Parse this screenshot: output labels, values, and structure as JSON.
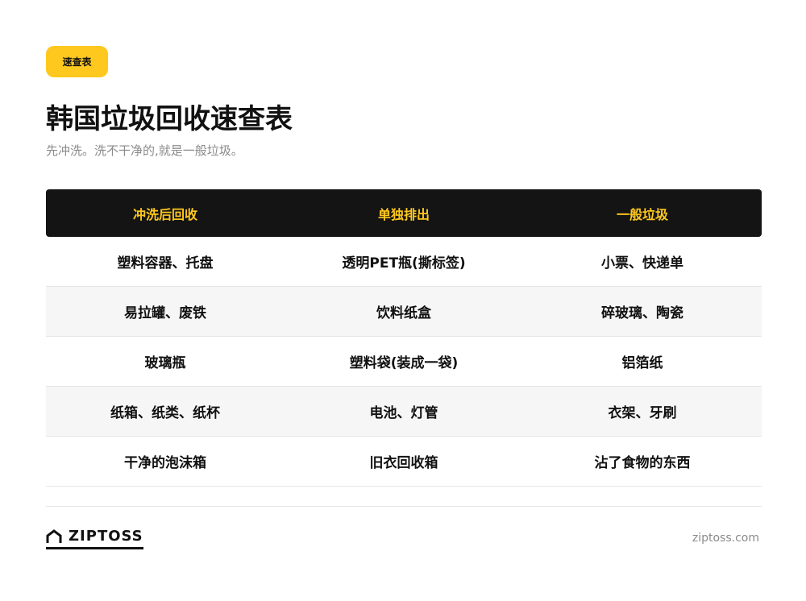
{
  "badge": "速查表",
  "title": "韩国垃圾回收速查表",
  "subtitle": "先冲洗。洗不干净的,就是一般垃圾。",
  "table": {
    "headers": [
      "冲洗后回收",
      "单独排出",
      "一般垃圾"
    ],
    "rows": [
      [
        "塑料容器、托盘",
        "透明PET瓶(撕标签)",
        "小票、快递单"
      ],
      [
        "易拉罐、废铁",
        "饮料纸盒",
        "碎玻璃、陶瓷"
      ],
      [
        "玻璃瓶",
        "塑料袋(装成一袋)",
        "铝箔纸"
      ],
      [
        "纸箱、纸类、纸杯",
        "电池、灯管",
        "衣架、牙刷"
      ],
      [
        "干净的泡沫箱",
        "旧衣回收箱",
        "沾了食物的东西"
      ]
    ]
  },
  "footer": {
    "logo_text": "ZIPTOSS",
    "logo_icon": "house-icon",
    "site": "ziptoss.com"
  },
  "colors": {
    "accent": "#FFC81E",
    "header_bg": "#141414",
    "text": "#111111",
    "muted": "#8a8a8a",
    "row_alt": "#f6f6f6"
  }
}
